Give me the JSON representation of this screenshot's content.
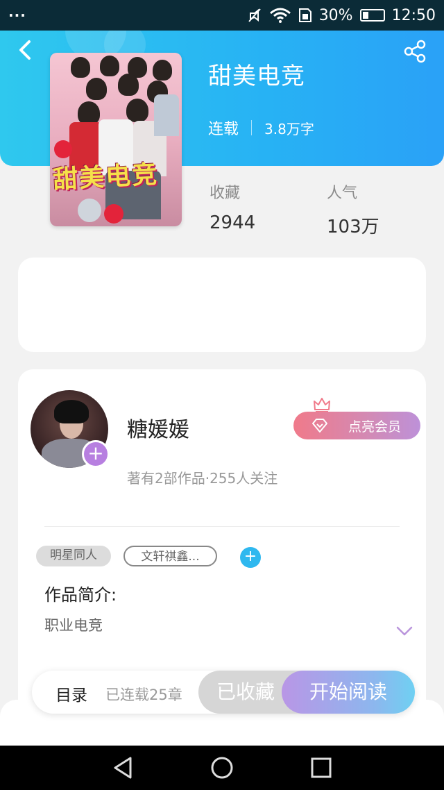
{
  "status_bar": {
    "dots": "···",
    "battery": "30%",
    "time": "12:50",
    "battery_level": 0.3
  },
  "book": {
    "title": "甜美电竞",
    "cover_title": "甜美电竞",
    "status": "连载",
    "word_count": "3.8万字"
  },
  "stats": [
    {
      "label": "收藏",
      "value": "2944"
    },
    {
      "label": "人气",
      "value": "103万"
    }
  ],
  "author": {
    "name": "糖媛媛",
    "meta": "著有2部作品·255人关注",
    "vip_label": "点亮会员",
    "avatar_add": "+"
  },
  "tags": {
    "items": [
      "明星同人",
      "文轩祺鑫..."
    ],
    "add": "+"
  },
  "intro": {
    "title": "作品简介:",
    "text": "职业电竞"
  },
  "bottom_bar": {
    "catalog": "目录",
    "chapters": "已连载25章",
    "collected": "已收藏",
    "read": "开始阅读"
  },
  "colors": {
    "header_gradient": [
      "#2fc8ee",
      "#2aa1f7"
    ],
    "accent_purple": "#b77fe0",
    "tag_add": "#2fb8ef"
  },
  "icons": {
    "back": "back-arrow-icon",
    "share": "share-icon",
    "mute": "mute-icon",
    "wifi": "wifi-icon",
    "sim": "sim-icon",
    "vip": "diamond-icon",
    "crown": "crown-icon",
    "expand": "chevron-down-icon"
  }
}
